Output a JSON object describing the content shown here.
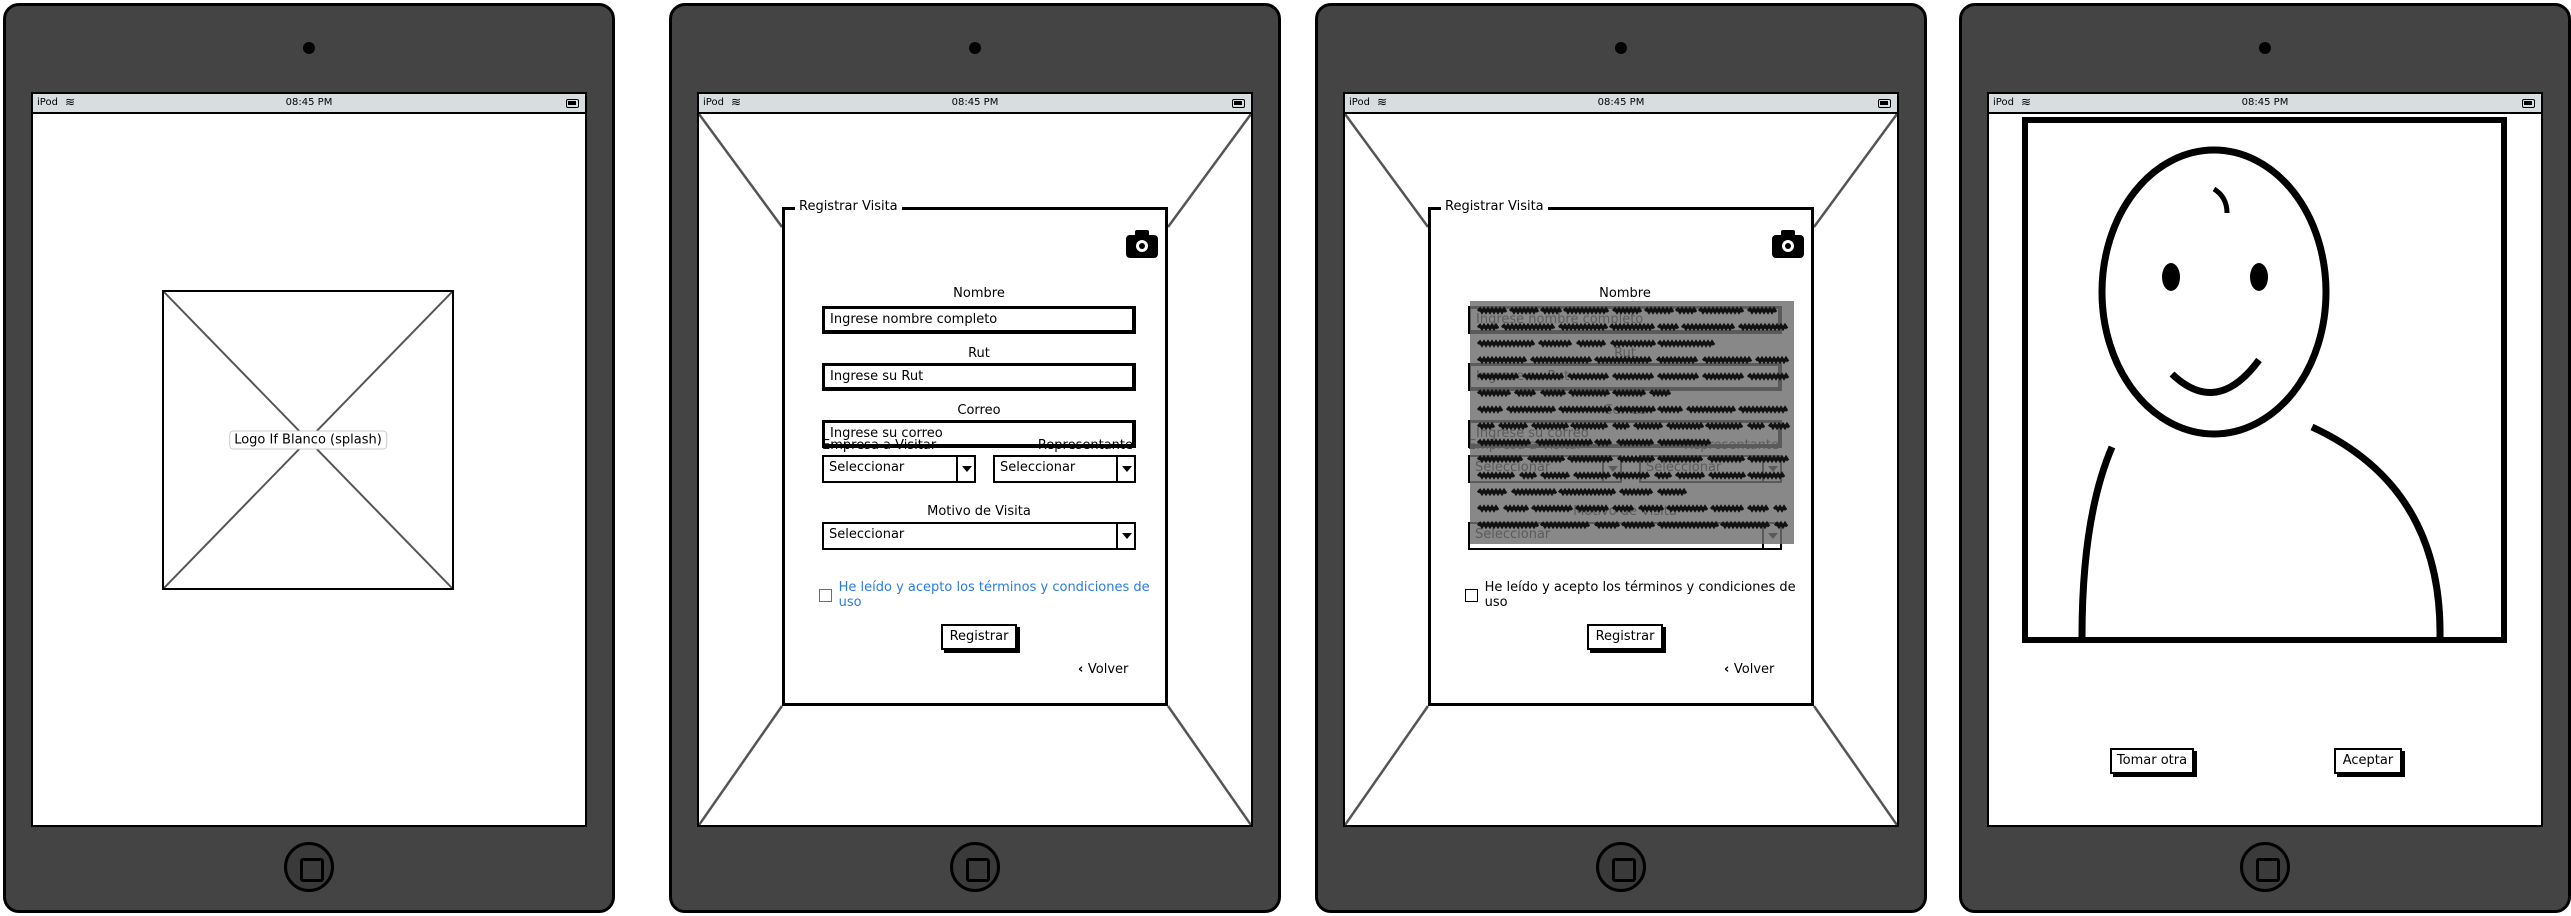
{
  "status_bar": {
    "carrier": "iPod",
    "time": "08:45 PM"
  },
  "splash": {
    "logo_label": "Logo If Blanco (splash)"
  },
  "form": {
    "legend": "Registrar Visita",
    "nombre_label": "Nombre",
    "nombre_placeholder": "Ingrese nombre completo",
    "rut_label": "Rut",
    "rut_placeholder": "Ingrese su Rut",
    "correo_label": "Correo",
    "correo_placeholder": "Ingrese su correo",
    "empresa_label": "Empresa a Visitar",
    "empresa_value": "Seleccionar",
    "representante_label": "Representante",
    "representante_value": "Seleccionar",
    "motivo_label": "Motivo de Visita",
    "motivo_value": "Seleccionar",
    "terms_label": "He leído y acepto los términos y condiciones de uso",
    "register_button": "Registrar",
    "back_label": "Volver"
  },
  "colors": {
    "device": "#444444",
    "terms_link": "#2a7be0",
    "status_bar": "#d8dde0"
  },
  "photo": {
    "retake_button": "Tomar otra",
    "accept_button": "Aceptar"
  }
}
